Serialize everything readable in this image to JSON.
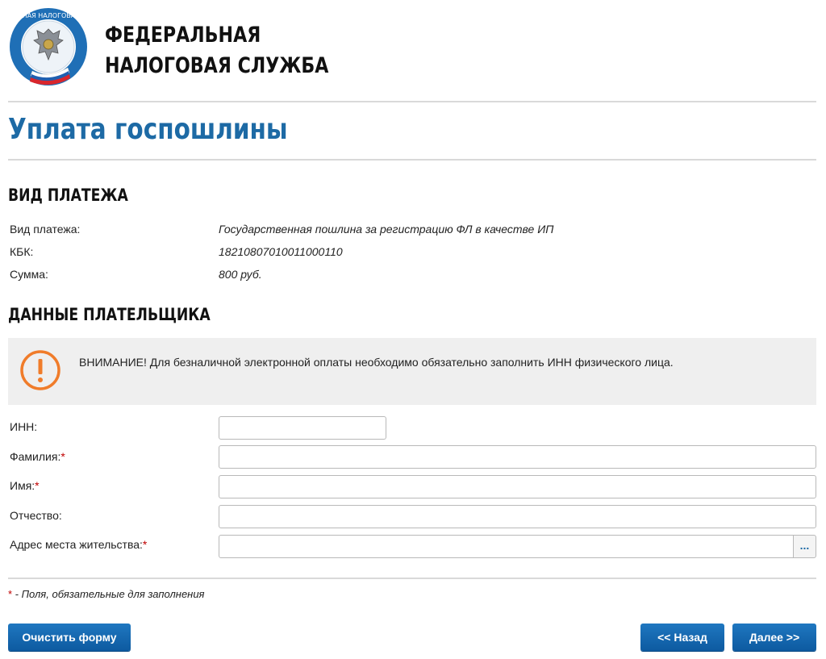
{
  "header": {
    "logo_text": "ФЕДЕРАЛЬНАЯ НАЛОГОВАЯ СЛУЖБА",
    "org_line1": "ФЕДЕРАЛЬНАЯ",
    "org_line2": "НАЛОГОВАЯ СЛУЖБА"
  },
  "page_title": "Уплата госпошлины",
  "payment_type": {
    "section_title": "ВИД ПЛАТЕЖА",
    "rows": [
      {
        "label": "Вид платежа:",
        "value": "Государственная пошлина за регистрацию ФЛ в качестве ИП"
      },
      {
        "label": "КБК:",
        "value": "18210807010011000110"
      },
      {
        "label": "Сумма:",
        "value": "800 руб."
      }
    ]
  },
  "payer": {
    "section_title": "ДАННЫЕ ПЛАТЕЛЬЩИКА",
    "notice": "ВНИМАНИЕ! Для безналичной электронной оплаты необходимо обязательно заполнить ИНН физического лица.",
    "fields": {
      "inn": {
        "label": "ИНН:",
        "value": ""
      },
      "last_name": {
        "label": "Фамилия:",
        "required_mark": "*",
        "value": ""
      },
      "first_name": {
        "label": "Имя:",
        "required_mark": "*",
        "value": ""
      },
      "patronymic": {
        "label": "Отчество:",
        "value": ""
      },
      "address": {
        "label": "Адрес места жительства:",
        "required_mark": "*",
        "value": "",
        "picker_label": "..."
      }
    }
  },
  "footnote": {
    "mark": "*",
    "text": " - Поля, обязательные для заполнения"
  },
  "buttons": {
    "clear": "Очистить форму",
    "back": "<< Назад",
    "next": "Далее >>"
  },
  "colors": {
    "accent": "#1d6aa5",
    "button": "#1466ad",
    "notice_bg": "#efefef",
    "notice_icon": "#f07c2a",
    "required": "#c00000"
  }
}
